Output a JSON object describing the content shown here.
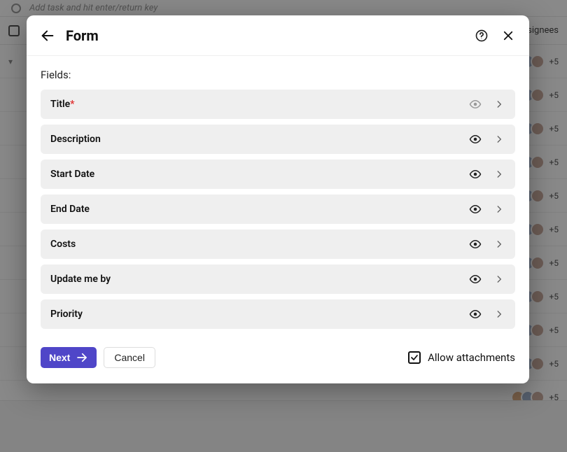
{
  "background": {
    "add_task_placeholder": "Add task and hit enter/return key",
    "assignees_header": "ssignees",
    "row_extra": "+5",
    "row_count": 11
  },
  "modal": {
    "title": "Form",
    "fields_label": "Fields:",
    "fields": [
      {
        "label": "Title",
        "required": true,
        "visible_dimmed": true
      },
      {
        "label": "Description",
        "required": false,
        "visible_dimmed": false
      },
      {
        "label": "Start Date",
        "required": false,
        "visible_dimmed": false
      },
      {
        "label": "End Date",
        "required": false,
        "visible_dimmed": false
      },
      {
        "label": "Costs",
        "required": false,
        "visible_dimmed": false
      },
      {
        "label": "Update me by",
        "required": false,
        "visible_dimmed": false
      },
      {
        "label": "Priority",
        "required": false,
        "visible_dimmed": false
      }
    ],
    "next_label": "Next",
    "cancel_label": "Cancel",
    "allow_attachments_label": "Allow attachments",
    "allow_attachments_checked": true,
    "colors": {
      "primary": "#4f46c8",
      "required": "#e03030"
    }
  }
}
